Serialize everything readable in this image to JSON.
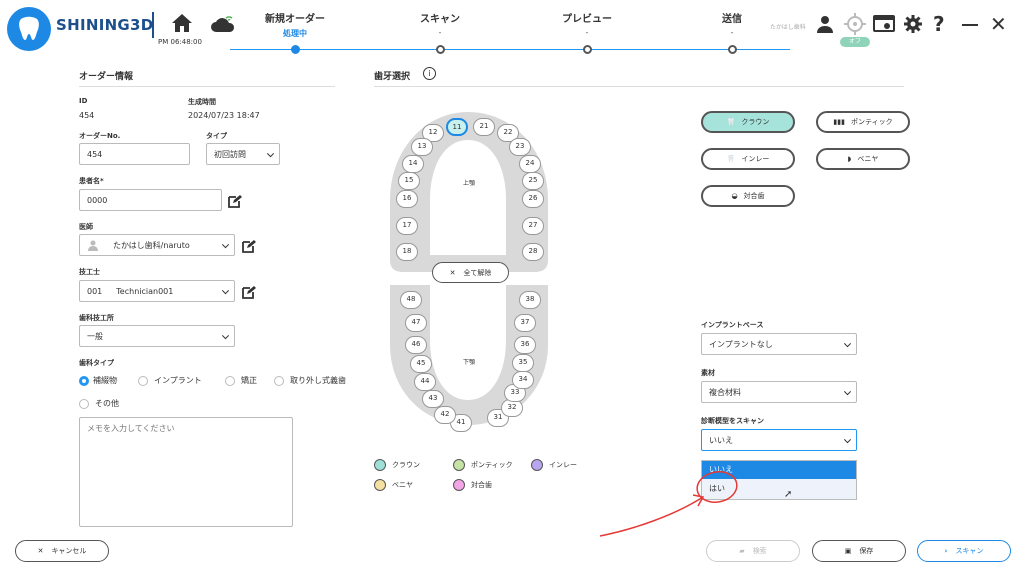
{
  "header": {
    "brand": "SHINING3D",
    "time": "PM 06:48:00",
    "user": "たかはし歯科",
    "badge": "オフ"
  },
  "steps": [
    {
      "label": "新規オーダー",
      "sub": "処理中"
    },
    {
      "label": "スキャン",
      "sub": "-"
    },
    {
      "label": "プレビュー",
      "sub": "-"
    },
    {
      "label": "送信",
      "sub": "-"
    }
  ],
  "order": {
    "title": "オーダー情報",
    "id_label": "ID",
    "id": "454",
    "created_label": "生成時間",
    "created": "2024/07/23 18:47",
    "order_no_label": "オーダーNo.",
    "order_no": "454",
    "type_label": "タイプ",
    "type": "初回訪問",
    "patient_label": "患者名*",
    "patient": "0000",
    "doctor_label": "医師",
    "doctor": "たかはし歯科/naruto",
    "tech_label": "技工士",
    "tech_id": "001",
    "tech": "Technician001",
    "lab_label": "歯科技工所",
    "lab": "一般",
    "dtype_label": "歯科タイプ",
    "dtypes": [
      "補綴物",
      "インプラント",
      "矯正",
      "取り外し式義歯",
      "その他"
    ],
    "memo_placeholder": "メモを入力してください"
  },
  "teeth": {
    "title": "歯牙選択",
    "upper": "上顎",
    "lower": "下顎",
    "clear": "全て解除",
    "upper_right": [
      "11",
      "12",
      "13",
      "14",
      "15",
      "16",
      "17",
      "18"
    ],
    "upper_left": [
      "21",
      "22",
      "23",
      "24",
      "25",
      "26",
      "27",
      "28"
    ],
    "lower_left": [
      "31",
      "32",
      "33",
      "34",
      "35",
      "36",
      "37",
      "38"
    ],
    "lower_right": [
      "41",
      "42",
      "43",
      "44",
      "45",
      "46",
      "47",
      "48"
    ]
  },
  "legend": [
    "クラウン",
    "ポンティック",
    "インレー",
    "ベニヤ",
    "対合歯"
  ],
  "legend_colors": [
    "#9ee0d8",
    "#c5e3a5",
    "#b9a6f0",
    "#f4e0a0",
    "#f3a6e6"
  ],
  "types": {
    "crown": "クラウン",
    "pontic": "ポンティック",
    "inlay": "インレー",
    "veneer": "ベニヤ",
    "antagonist": "対合歯"
  },
  "right": {
    "implant_label": "インプラントベース",
    "implant": "インプラントなし",
    "material_label": "素材",
    "material": "複合材料",
    "scan_label": "診断模型をスキャン",
    "scan": "いいえ",
    "options": [
      "いいえ",
      "はい"
    ]
  },
  "footer": {
    "cancel": "キャンセル",
    "search": "検索",
    "save": "保存",
    "scan": "スキャン"
  }
}
